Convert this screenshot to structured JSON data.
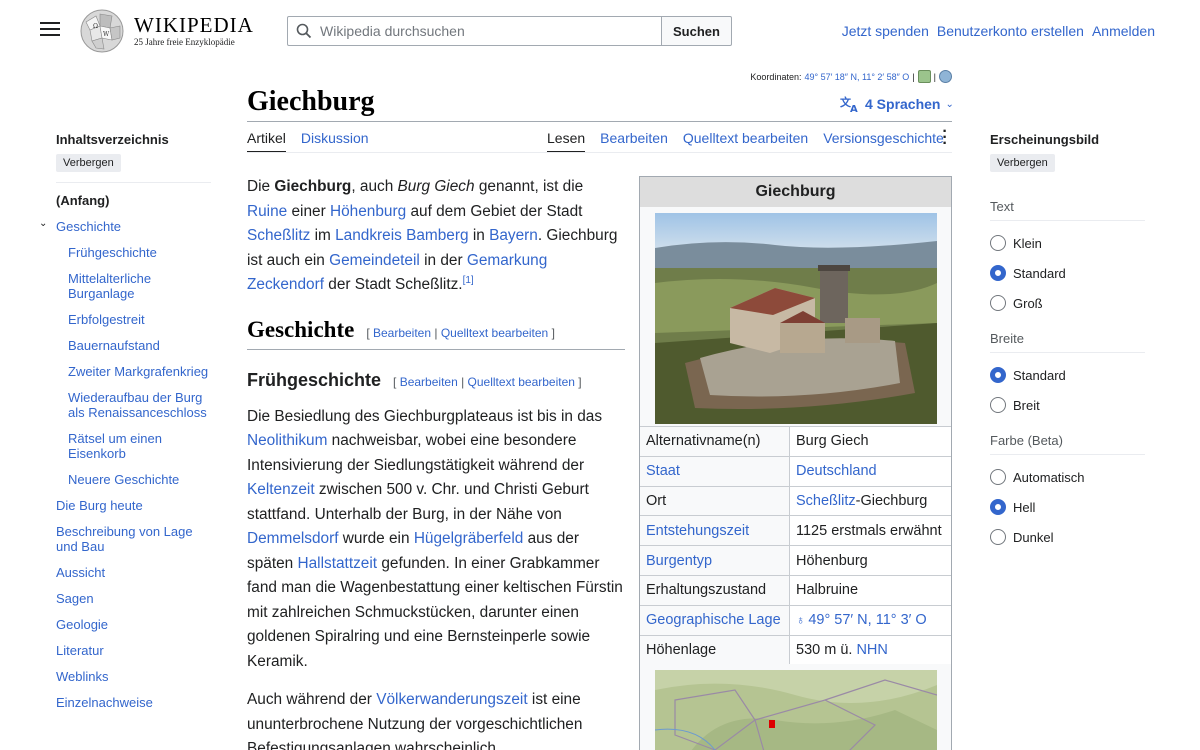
{
  "header": {
    "logo_word": "WIKIPEDIA",
    "logo_tagline": "25 Jahre freie Enzyklopädie",
    "search_placeholder": "Wikipedia durchsuchen",
    "search_button": "Suchen",
    "links": [
      "Jetzt spenden",
      "Benutzerkonto erstellen",
      "Anmelden"
    ]
  },
  "coords": {
    "label": "Koordinaten:",
    "value": "49° 57′ 18″ N, 11° 2′ 58″ O",
    "separator": "|"
  },
  "page": {
    "title": "Giechburg",
    "languages": "4 Sprachen"
  },
  "tabs": {
    "left": [
      "Artikel",
      "Diskussion"
    ],
    "right": [
      "Lesen",
      "Bearbeiten",
      "Quelltext bearbeiten",
      "Versionsgeschichte"
    ]
  },
  "toc": {
    "heading": "Inhaltsverzeichnis",
    "hide": "Verbergen",
    "items": [
      {
        "label": "(Anfang)",
        "level": 0
      },
      {
        "label": "Geschichte",
        "level": 0
      },
      {
        "label": "Frühgeschichte",
        "level": 1
      },
      {
        "label": "Mittelalterliche Burganlage",
        "level": 1
      },
      {
        "label": "Erbfolgestreit",
        "level": 1
      },
      {
        "label": "Bauernaufstand",
        "level": 1
      },
      {
        "label": "Zweiter Markgrafenkrieg",
        "level": 1
      },
      {
        "label": "Wiederaufbau der Burg als Renaissanceschloss",
        "level": 1
      },
      {
        "label": "Rätsel um einen Eisenkorb",
        "level": 1
      },
      {
        "label": "Neuere Geschichte",
        "level": 1
      },
      {
        "label": "Die Burg heute",
        "level": 0
      },
      {
        "label": "Beschreibung von Lage und Bau",
        "level": 0
      },
      {
        "label": "Aussicht",
        "level": 0
      },
      {
        "label": "Sagen",
        "level": 0
      },
      {
        "label": "Geologie",
        "level": 0
      },
      {
        "label": "Literatur",
        "level": 0
      },
      {
        "label": "Weblinks",
        "level": 0
      },
      {
        "label": "Einzelnachweise",
        "level": 0
      }
    ]
  },
  "intro": {
    "t1": "Die ",
    "b1": "Giechburg",
    "t2": ", auch ",
    "i1": "Burg Giech",
    "t3": " genannt, ist die ",
    "l1": "Ruine",
    "t4": " einer ",
    "l2": "Höhenburg",
    "t5": " auf dem Gebiet der Stadt ",
    "l3": "Scheßlitz",
    "t6": " im ",
    "l4": "Landkreis Bamberg",
    "t7": " in ",
    "l5": "Bayern",
    "t8": ". Giechburg ist auch ein ",
    "l6": "Gemeindeteil",
    "t9": " in der ",
    "l7": "Gemarkung Zeckendorf",
    "t10": " der Stadt Scheßlitz.",
    "ref": "[1]"
  },
  "section_geschichte": {
    "heading": "Geschichte",
    "edit_open": "[ ",
    "edit1": "Bearbeiten",
    "edit_sep": " | ",
    "edit2": "Quelltext bearbeiten",
    "edit_close": " ]"
  },
  "section_frueh": {
    "heading": "Frühgeschichte",
    "edit_open": "[ ",
    "edit1": "Bearbeiten",
    "edit_sep": " | ",
    "edit2": "Quelltext bearbeiten",
    "edit_close": " ]"
  },
  "para1": {
    "t1": "Die Besiedlung des Giechburgplateaus ist bis in das ",
    "l1": "Neolithikum",
    "t2": " nachweisbar, wobei eine besondere Intensivierung der Siedlungstätigkeit während der ",
    "l2": "Keltenzeit",
    "t3": " zwischen 500 v. Chr. und Christi Geburt stattfand. Unterhalb der Burg, in der Nähe von ",
    "l3": "Demmelsdorf",
    "t4": " wurde ein ",
    "l4": "Hügelgräberfeld",
    "t5": " aus der späten ",
    "l5": "Hallstattzeit",
    "t6": " gefunden. In einer Grabkammer fand man die Wagenbestattung einer keltischen Fürstin mit zahlreichen Schmuckstücken, darunter einen goldenen Spiralring und eine Bernsteinperle sowie Keramik."
  },
  "para2": {
    "t1": "Auch während der ",
    "l1": "Völkerwanderungszeit",
    "t2": " ist eine ununterbrochene Nutzung der vorgeschichtlichen Befestigungsanlagen wahrscheinlich."
  },
  "infobox": {
    "title": "Giechburg",
    "rows": [
      {
        "label": "Alternativname(n)",
        "label_link": false,
        "value": "Burg Giech"
      },
      {
        "label": "Staat",
        "label_link": true,
        "value": "Deutschland"
      },
      {
        "label": "Ort",
        "label_link": false,
        "value_link": "Scheßlitz",
        "value_rest": "-Giechburg"
      },
      {
        "label": "Entstehungszeit",
        "label_link": true,
        "value": "1125 erstmals erwähnt"
      },
      {
        "label": "Burgentyp",
        "label_link": true,
        "value": "Höhenburg"
      },
      {
        "label": "Erhaltungszustand",
        "label_link": false,
        "value": "Halbruine"
      },
      {
        "label": "Geographische Lage",
        "label_link": true,
        "value": "49° 57′ N, 11° 3′ O"
      },
      {
        "label": "Höhenlage",
        "label_link": false,
        "value": "530 m ü. ",
        "value_link2": "NHN"
      }
    ]
  },
  "appearance": {
    "heading": "Erscheinungsbild",
    "hide": "Verbergen",
    "groups": [
      {
        "name": "Text",
        "options": [
          "Klein",
          "Standard",
          "Groß"
        ],
        "selected": "Standard"
      },
      {
        "name": "Breite",
        "options": [
          "Standard",
          "Breit"
        ],
        "selected": "Standard"
      },
      {
        "name": "Farbe (Beta)",
        "options": [
          "Automatisch",
          "Hell",
          "Dunkel"
        ],
        "selected": "Hell"
      }
    ]
  },
  "colors": {
    "link": "#3366cc",
    "text": "#202122",
    "infobox_title_bg": "#dddddd"
  }
}
